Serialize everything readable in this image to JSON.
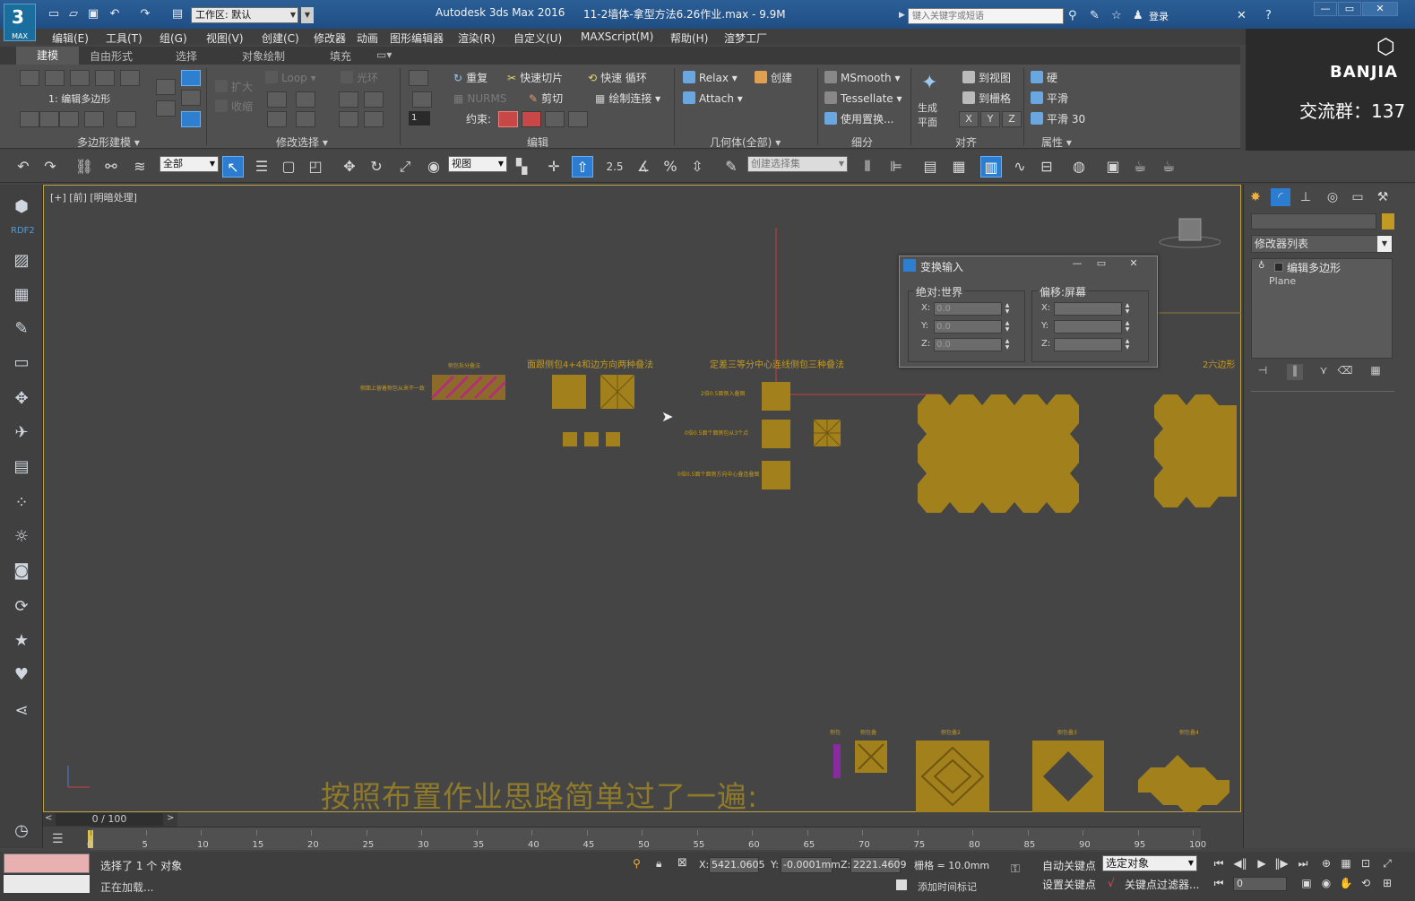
{
  "titlebar": {
    "logo_text": "MAX",
    "workspace_label": "工作区: 默认",
    "app_title": "Autodesk 3ds Max 2016",
    "file_title": "11-2墙体-拿型方法6.26作业.max - 9.9M",
    "search_placeholder": "键入关键字或短语",
    "login": "登录"
  },
  "menu": [
    "编辑(E)",
    "工具(T)",
    "组(G)",
    "视图(V)",
    "创建(C)",
    "修改器",
    "动画",
    "图形编辑器",
    "渲染(R)",
    "自定义(U)",
    "MAXScript(M)",
    "帮助(H)",
    "渲梦工厂"
  ],
  "ribbon": {
    "tabs": [
      "建模",
      "自由形式",
      "选择",
      "对象绘制",
      "填充"
    ],
    "mode_label": "1: 编辑多边形",
    "groups": [
      "多边形建模",
      "修改选择",
      "编辑",
      "几何体(全部)",
      "细分",
      "对齐",
      "属性"
    ],
    "select_ops": [
      "扩大",
      "收缩",
      "Loop",
      "光环"
    ],
    "edit": {
      "repeat": "重复",
      "quickslice": "快速切片",
      "quickloop": "快速 循环",
      "nurms": "NURMS",
      "cut": "剪切",
      "paintconnect": "绘制连接",
      "constraint": "约束:",
      "spin_value": "1"
    },
    "geometry": {
      "relax": "Relax",
      "create": "创建",
      "attach": "Attach"
    },
    "subdivide": {
      "msmooth": "MSmooth",
      "tessellate": "Tessellate",
      "useplace": "使用置换..."
    },
    "align": {
      "make_planar": "生成",
      "make_planar2": "平面",
      "to_view": "到视图",
      "to_grid": "到栅格",
      "x": "X",
      "y": "Y",
      "z": "Z"
    },
    "properties": {
      "hard": "硬",
      "smooth": "平滑",
      "smooth30": "平滑 30"
    }
  },
  "brand": {
    "name": "BANJIA",
    "qq_label": "交流群：137"
  },
  "toolbar": {
    "filter": "全部",
    "refcoord": "视图",
    "snap_label": "2.5",
    "named_selection": "创建选择集"
  },
  "leftbar": {
    "rdf": "RDF2"
  },
  "viewport": {
    "label": "[+] [前] [明暗处理]",
    "caption": "按照布置作业思路简单过了一遍:",
    "labels": {
      "group1": "面跟侧包4+4和边方向两种叠法",
      "group2": "定差三等分中心连线侧包三种叠法",
      "hatched": "侧包拆分叠法",
      "left_note": "侧面上留着侧包从来不一致",
      "mid1": "2倍0.5面侧入叠图",
      "mid2": "0倍0.5面个面侧包从3个点",
      "mid3": "0倍0.5面个面侧方向中心叠连叠图",
      "right": "2六边形",
      "b1": "侧包",
      "b2": "侧包叠",
      "b3": "侧包叠2",
      "b4": "侧包叠3",
      "b5": "侧包叠4"
    }
  },
  "transform_dialog": {
    "title": "变换输入",
    "absolute": "绝对:世界",
    "offset": "偏移:屏幕",
    "x_label": "X:",
    "y_label": "Y:",
    "z_label": "Z:",
    "abs_x": "0.0",
    "abs_y": "0.0",
    "abs_z": "0.0"
  },
  "cmdpanel": {
    "modifier_list": "修改器列表",
    "stack": [
      "编辑多边形",
      "Plane"
    ]
  },
  "timeline": {
    "frame": "0 / 100",
    "ticks": [
      "0",
      "5",
      "10",
      "15",
      "20",
      "25",
      "30",
      "35",
      "40",
      "45",
      "50",
      "55",
      "60",
      "65",
      "70",
      "75",
      "80",
      "85",
      "90",
      "95",
      "100"
    ]
  },
  "status": {
    "selected": "选择了 1 个 对象",
    "loading": "正在加载...",
    "x_label": "X:",
    "y_label": "Y:",
    "z_label": "Z:",
    "x": "5421.0605",
    "y": "-0.0001mm",
    "z": "2221.4609",
    "grid": "栅格 = 10.0mm",
    "autokey": "自动关键点",
    "selobj": "选定对象",
    "setkey": "设置关键点",
    "keyfilter": "关键点过滤器...",
    "addtime": "添加时间标记",
    "frame": "0"
  },
  "colors": {
    "object_gold": "#a2811d",
    "accent_blue": "#2c7dd1",
    "label_gold": "#c29a22"
  }
}
